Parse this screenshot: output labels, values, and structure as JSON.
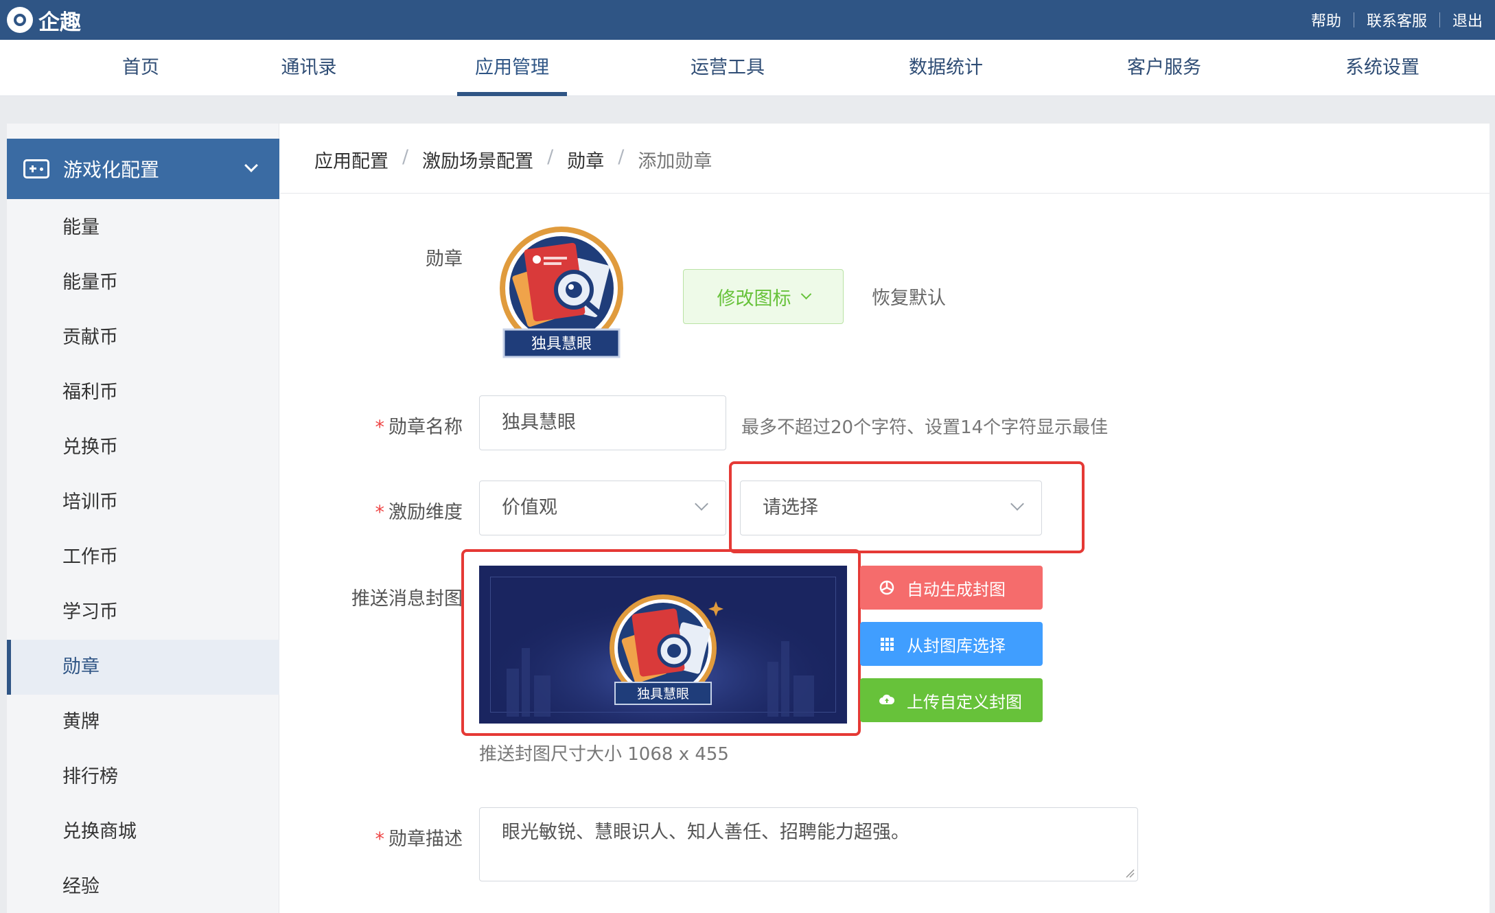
{
  "header": {
    "logo_text": "企趣",
    "links": [
      "帮助",
      "联系客服",
      "退出"
    ]
  },
  "nav": {
    "items": [
      "首页",
      "通讯录",
      "应用管理",
      "运营工具",
      "数据统计",
      "客户服务",
      "系统设置"
    ],
    "active": "应用管理"
  },
  "sidebar": {
    "group_label": "游戏化配置",
    "items": [
      "能量",
      "能量币",
      "贡献币",
      "福利币",
      "兑换币",
      "培训币",
      "工作币",
      "学习币",
      "勋章",
      "黄牌",
      "排行榜",
      "兑换商城",
      "经验"
    ],
    "active": "勋章"
  },
  "breadcrumb": [
    "应用配置",
    "激励场景配置",
    "勋章",
    "添加勋章"
  ],
  "form": {
    "badge_label": "勋章",
    "badge_banner_text": "独具慧眼",
    "change_icon_button": "修改图标",
    "restore_default": "恢复默认",
    "name_label": "勋章名称",
    "name_value": "独具慧眼",
    "name_hint": "最多不超过20个字符、设置14个字符显示最佳",
    "dimension_label": "激励维度",
    "dimension_value": "价值观",
    "dimension_sub_placeholder": "请选择",
    "cover_label": "推送消息封图",
    "cover_banner_text": "独具慧眼",
    "cover_size_hint": "推送封图尺寸大小 1068 x 455",
    "auto_generate_button": "自动生成封图",
    "library_button": "从封图库选择",
    "upload_button": "上传自定义封图",
    "desc_label": "勋章描述",
    "desc_value": "眼光敏锐、慧眼识人、知人善任、招聘能力超强。"
  },
  "colors": {
    "primary": "#2f5585",
    "sidebar_header": "#3a6ba3",
    "success": "#67c23a",
    "danger_btn": "#f56c6c",
    "info_btn": "#409eff",
    "annotation_red": "#e53935"
  }
}
